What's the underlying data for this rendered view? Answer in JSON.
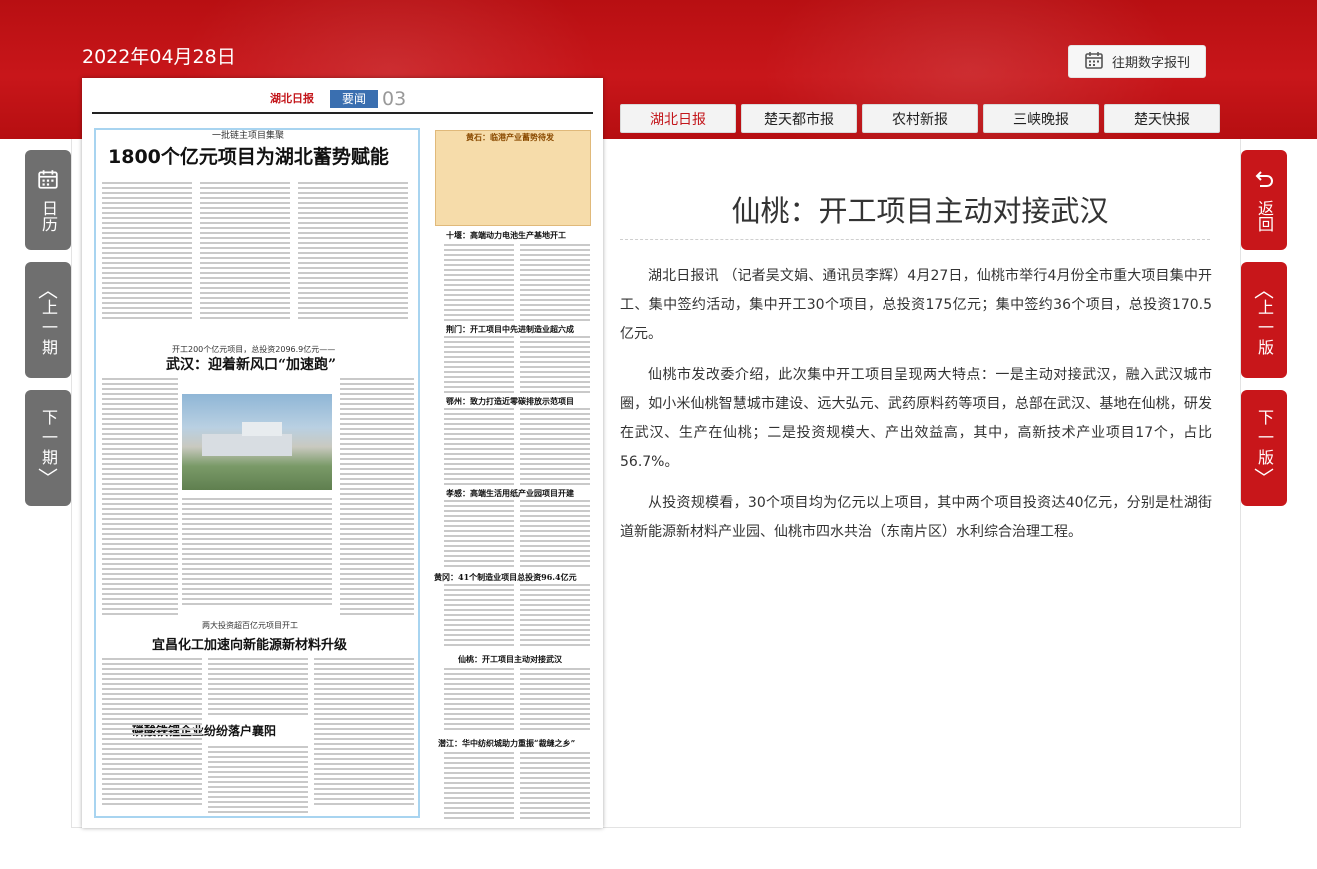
{
  "header": {
    "date": "2022年04月28日",
    "archive_button": "往期数字报刊",
    "archive_icon": "calendar-icon"
  },
  "paper_tabs": [
    {
      "label": "湖北日报",
      "active": true
    },
    {
      "label": "楚天都市报",
      "active": false
    },
    {
      "label": "农村新报",
      "active": false
    },
    {
      "label": "三峡晚报",
      "active": false
    },
    {
      "label": "楚天快报",
      "active": false
    }
  ],
  "left_nav": {
    "calendar": {
      "label": "日历",
      "icon": "calendar-icon"
    },
    "prev_issue": {
      "label": "上一期",
      "icon": "chevron-up-icon"
    },
    "next_issue": {
      "label": "下一期",
      "icon": "chevron-down-icon"
    }
  },
  "right_nav": {
    "back": {
      "label": "返回",
      "icon": "return-icon"
    },
    "prev_page": {
      "label": "上一版",
      "icon": "chevron-up-icon"
    },
    "next_page": {
      "label": "下一版",
      "icon": "chevron-down-icon"
    }
  },
  "colors": {
    "brand_red": "#c8161a",
    "nav_gray": "#6f6f6f"
  },
  "newspaper_page": {
    "logo": "湖北日报",
    "section_badge": "要闻",
    "page_number": "03",
    "kicker_1": "一批链主项目集聚",
    "headline_1": "1800个亿元项目为湖北蓄势赋能",
    "kicker_2": "开工200个亿元项目，总投资2096.9亿元——",
    "headline_2": "武汉：迎着新风口“加速跑”",
    "kicker_3": "两大投资超百亿元项目开工",
    "headline_3": "宜昌化工加速向新能源新材料升级",
    "headline_4": "磷酸铁锂企业纷纷落户襄阳",
    "right_headlines": [
      "黄石：临港产业蓄势待发",
      "十堰：高端动力电池生产基地开工",
      "荆门：开工项目中先进制造业超六成",
      "鄂州：致力打造近零碳排放示范项目",
      "孝感：高端生活用纸产业园项目开建",
      "黄冈：41个制造业项目总投资96.4亿元",
      "仙桃：开工项目主动对接武汉",
      "潜江：华中纺织城助力重振“裁缝之乡”"
    ]
  },
  "article": {
    "title": "仙桃：开工项目主动对接武汉",
    "paragraphs": [
      "湖北日报讯 （记者吴文娟、通讯员李辉）4月27日，仙桃市举行4月份全市重大项目集中开工、集中签约活动，集中开工30个项目，总投资175亿元；集中签约36个项目，总投资170.5亿元。",
      "仙桃市发改委介绍，此次集中开工项目呈现两大特点：一是主动对接武汉，融入武汉城市圈，如小米仙桃智慧城市建设、远大弘元、武药原料药等项目，总部在武汉、基地在仙桃，研发在武汉、生产在仙桃；二是投资规模大、产出效益高，其中，高新技术产业项目17个，占比56.7%。",
      "从投资规模看，30个项目均为亿元以上项目，其中两个项目投资达40亿元，分别是杜湖街道新能源新材料产业园、仙桃市四水共治（东南片区）水利综合治理工程。"
    ]
  }
}
